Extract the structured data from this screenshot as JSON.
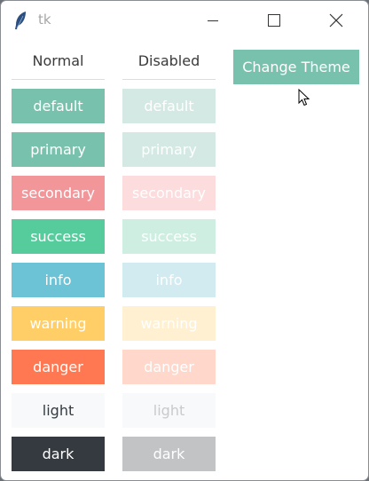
{
  "window": {
    "title": "tk"
  },
  "columns": {
    "normal": "Normal",
    "disabled": "Disabled"
  },
  "change_theme_button": {
    "label": "Change Theme"
  },
  "buttons": [
    {
      "label": "default",
      "normal_bg": "#78c2ad",
      "normal_fg": "#ffffff",
      "disabled_bg": "#d4e9e3",
      "disabled_fg": "#ffffff"
    },
    {
      "label": "primary",
      "normal_bg": "#78c2ad",
      "normal_fg": "#ffffff",
      "disabled_bg": "#d4e9e3",
      "disabled_fg": "#ffffff"
    },
    {
      "label": "secondary",
      "normal_bg": "#f3969a",
      "normal_fg": "#ffffff",
      "disabled_bg": "#fcdcdd",
      "disabled_fg": "#ffffff"
    },
    {
      "label": "success",
      "normal_bg": "#56cc9d",
      "normal_fg": "#ffffff",
      "disabled_bg": "#cdeee1",
      "disabled_fg": "#ffffff"
    },
    {
      "label": "info",
      "normal_bg": "#6cc3d5",
      "normal_fg": "#ffffff",
      "disabled_bg": "#d2ebf1",
      "disabled_fg": "#ffffff"
    },
    {
      "label": "warning",
      "normal_bg": "#ffce67",
      "normal_fg": "#ffffff",
      "disabled_bg": "#fff0d2",
      "disabled_fg": "#ffffff"
    },
    {
      "label": "danger",
      "normal_bg": "#ff7851",
      "normal_fg": "#ffffff",
      "disabled_bg": "#ffd7cb",
      "disabled_fg": "#ffffff"
    },
    {
      "label": "light",
      "normal_bg": "#f8f9fa",
      "normal_fg": "#343a40",
      "disabled_bg": "#f8f9fa",
      "disabled_fg": "#c8cacc"
    },
    {
      "label": "dark",
      "normal_bg": "#343a40",
      "normal_fg": "#ffffff",
      "disabled_bg": "#c2c3c5",
      "disabled_fg": "#ffffff"
    }
  ]
}
